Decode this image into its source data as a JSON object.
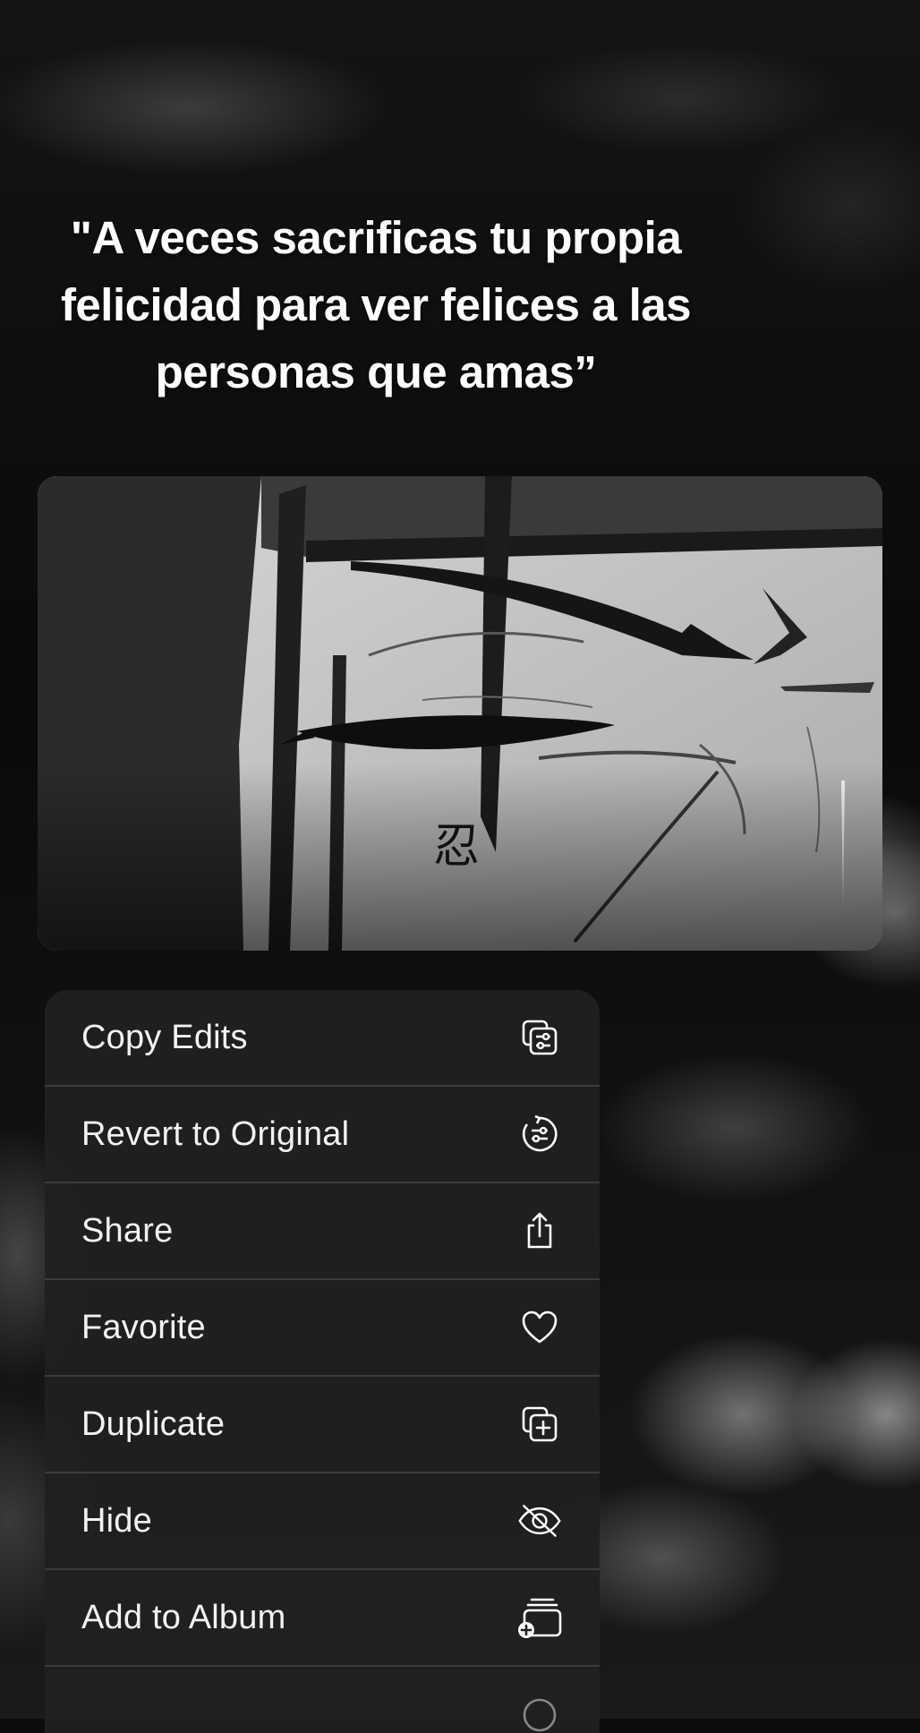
{
  "quote": {
    "text": "\"A veces sacrificas tu propia\nfelicidad para ver felices a las\npersonas que amas”"
  },
  "photo": {
    "overlay_text": "忍"
  },
  "menu": {
    "items": [
      {
        "label": "Copy Edits",
        "icon": "copy-edits-icon"
      },
      {
        "label": "Revert to Original",
        "icon": "revert-icon"
      },
      {
        "label": "Share",
        "icon": "share-icon"
      },
      {
        "label": "Favorite",
        "icon": "heart-icon"
      },
      {
        "label": "Duplicate",
        "icon": "duplicate-icon"
      },
      {
        "label": "Hide",
        "icon": "eye-slash-icon"
      },
      {
        "label": "Add to Album",
        "icon": "add-to-album-icon"
      }
    ]
  },
  "colors": {
    "menu_background": "#202020",
    "separator": "#3c3c3c",
    "text": "#ffffff"
  }
}
